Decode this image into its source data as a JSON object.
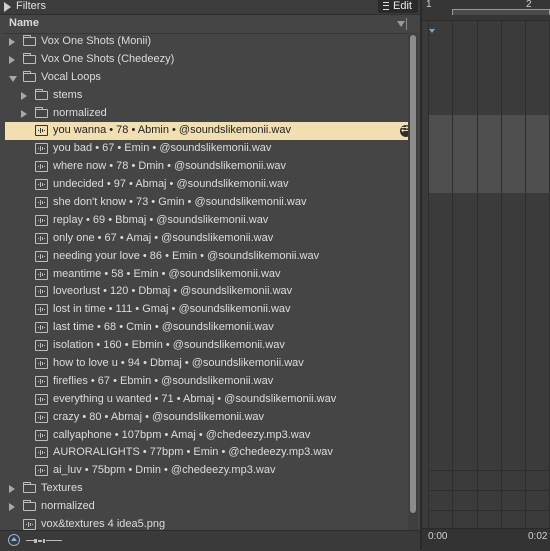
{
  "filters": {
    "label": "Filters",
    "edit_label": "Edit"
  },
  "header": {
    "name_label": "Name"
  },
  "tree": [
    {
      "type": "folder",
      "label": "Vox One Shots (Monii)",
      "expanded": false,
      "indent": 0
    },
    {
      "type": "folder",
      "label": "Vox One Shots (Chedeezy)",
      "expanded": false,
      "indent": 0
    },
    {
      "type": "folder",
      "label": "Vocal Loops",
      "expanded": true,
      "indent": 0
    },
    {
      "type": "folder",
      "label": "stems",
      "expanded": false,
      "indent": 1
    },
    {
      "type": "folder",
      "label": "normalized",
      "expanded": false,
      "indent": 1
    },
    {
      "type": "file",
      "label": "you wanna • 78 • Abmin • @soundslikemonii.wav",
      "selected": true,
      "indent": 1
    },
    {
      "type": "file",
      "label": "you bad • 67 • Emin • @soundslikemonii.wav",
      "indent": 1
    },
    {
      "type": "file",
      "label": "where now • 78 • Dmin • @soundslikemonii.wav",
      "indent": 1
    },
    {
      "type": "file",
      "label": "undecided • 97 • Abmaj • @soundslikemonii.wav",
      "indent": 1
    },
    {
      "type": "file",
      "label": "she don't know • 73 • Gmin • @soundslikemonii.wav",
      "indent": 1
    },
    {
      "type": "file",
      "label": "replay • 69 • Bbmaj • @soundslikemonii.wav",
      "indent": 1
    },
    {
      "type": "file",
      "label": "only one • 67 • Amaj • @soundslikemonii.wav",
      "indent": 1
    },
    {
      "type": "file",
      "label": "needing your love • 86 • Emin • @soundslikemonii.wav",
      "indent": 1
    },
    {
      "type": "file",
      "label": "meantime • 58 • Emin • @soundslikemonii.wav",
      "indent": 1
    },
    {
      "type": "file",
      "label": "loveorlust • 120 • Dbmaj • @soundslikemonii.wav",
      "indent": 1
    },
    {
      "type": "file",
      "label": "lost in time • 111 • Gmaj • @soundslikemonii.wav",
      "indent": 1
    },
    {
      "type": "file",
      "label": "last time • 68 • Cmin • @soundslikemonii.wav",
      "indent": 1
    },
    {
      "type": "file",
      "label": "isolation • 160 • Ebmin • @soundslikemonii.wav",
      "indent": 1
    },
    {
      "type": "file",
      "label": "how to love u • 94 • Dbmaj • @soundslikemonii.wav",
      "indent": 1
    },
    {
      "type": "file",
      "label": "fireflies • 67 • Ebmin • @soundslikemonii.wav",
      "indent": 1
    },
    {
      "type": "file",
      "label": "everything u wanted • 71 • Abmaj • @soundslikemonii.wav",
      "indent": 1
    },
    {
      "type": "file",
      "label": "crazy • 80 • Abmaj • @soundslikemonii.wav",
      "indent": 1
    },
    {
      "type": "file",
      "label": "callyaphone • 107bpm • Amaj • @chedeezy.mp3.wav",
      "indent": 1
    },
    {
      "type": "file",
      "label": "AURORALIGHTS • 77bpm • Emin • @chedeezy.mp3.wav",
      "indent": 1
    },
    {
      "type": "file",
      "label": "ai_luv • 75bpm • Dmin • @chedeezy.mp3.wav",
      "indent": 1
    },
    {
      "type": "folder",
      "label": "Textures",
      "expanded": false,
      "indent": 0
    },
    {
      "type": "folder",
      "label": "normalized",
      "expanded": false,
      "indent": 0
    },
    {
      "type": "file",
      "label": "vox&textures 4 idea5.png",
      "indent": 0
    }
  ],
  "arrangement": {
    "bar_labels": [
      "1",
      "2"
    ],
    "time_labels": [
      "0:00",
      "0:02"
    ]
  },
  "colors": {
    "selection": "#f1dfb2",
    "accent": "#8fb2d8"
  },
  "icons": [
    "folder-icon",
    "audio-file-icon",
    "chevron-right-icon",
    "chevron-down-icon",
    "hotswap-icon",
    "preview-icon",
    "sort-arrow-icon"
  ]
}
